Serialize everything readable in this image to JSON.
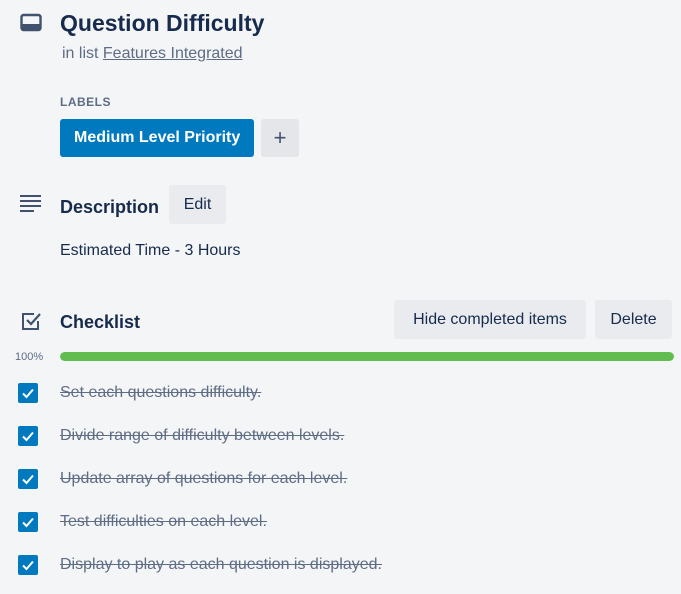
{
  "card": {
    "title": "Question Difficulty",
    "in_list_prefix": "in list",
    "list_name": "Features Integrated"
  },
  "labels": {
    "heading": "LABELS",
    "items": [
      {
        "text": "Medium Level Priority",
        "color": "#0079bf"
      }
    ],
    "add_symbol": "+"
  },
  "description": {
    "heading": "Description",
    "edit_label": "Edit",
    "text": "Estimated Time - 3 Hours"
  },
  "checklist": {
    "heading": "Checklist",
    "hide_label": "Hide completed items",
    "delete_label": "Delete",
    "progress_text": "100%",
    "progress": 1.0,
    "progress_color": "#61bd4f",
    "items": [
      {
        "text": "Set each questions difficulty.",
        "checked": true
      },
      {
        "text": "Divide range of difficulty between levels.",
        "checked": true
      },
      {
        "text": "Update array of questions for each level.",
        "checked": true
      },
      {
        "text": "Test difficulties on each level.",
        "checked": true
      },
      {
        "text": "Display to play as each question is displayed.",
        "checked": true
      }
    ]
  },
  "icons": {
    "card": "card-icon",
    "description": "description-lines-icon",
    "checklist": "checklist-icon",
    "check": "checkmark-icon"
  }
}
